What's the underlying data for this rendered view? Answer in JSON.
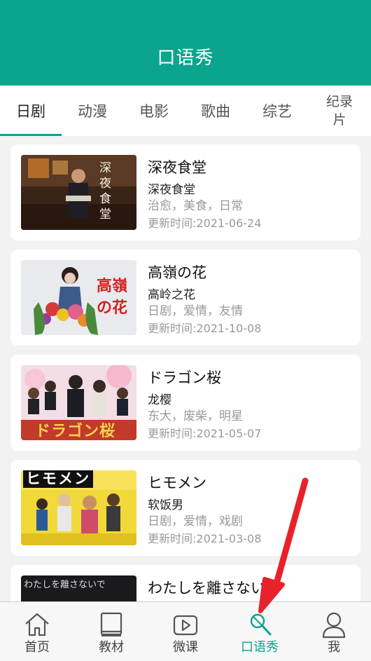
{
  "header": {
    "title": "口语秀"
  },
  "tabs": [
    {
      "label": "日剧",
      "active": true
    },
    {
      "label": "动漫"
    },
    {
      "label": "电影"
    },
    {
      "label": "歌曲"
    },
    {
      "label": "综艺"
    },
    {
      "label_line1": "纪录",
      "label_line2": "片"
    }
  ],
  "items": [
    {
      "title": "深夜食堂",
      "subtitle": "深夜食堂",
      "tags": "治愈，美食，日常",
      "date": "更新时间:2021-06-24",
      "poster_text": "深夜食堂"
    },
    {
      "title": "高嶺の花",
      "subtitle": "高岭之花",
      "tags": "日剧，爱情，友情",
      "date": "更新时间:2021-10-08",
      "poster_text": "高嶺の花"
    },
    {
      "title": "ドラゴン桜",
      "subtitle": "龙樱",
      "tags": "东大，废柴，明星",
      "date": "更新时间:2021-05-07",
      "poster_text": "ドラゴン桜"
    },
    {
      "title": "ヒモメン",
      "subtitle": "软饭男",
      "tags": "日剧，爱情，戏剧",
      "date": "更新时间:2021-03-08",
      "poster_text": "ヒモメン"
    },
    {
      "title": "わたしを離さない",
      "poster_text": "わたしを離さないで"
    }
  ],
  "tabbar": [
    {
      "label": "首页",
      "icon": "home-icon"
    },
    {
      "label": "教材",
      "icon": "book-icon"
    },
    {
      "label": "微课",
      "icon": "play-icon"
    },
    {
      "label": "口语秀",
      "icon": "microphone-icon",
      "active": true
    },
    {
      "label": "我",
      "icon": "user-icon"
    }
  ],
  "colors": {
    "accent": "#0aa58c",
    "annotation_arrow": "#e8222b"
  }
}
